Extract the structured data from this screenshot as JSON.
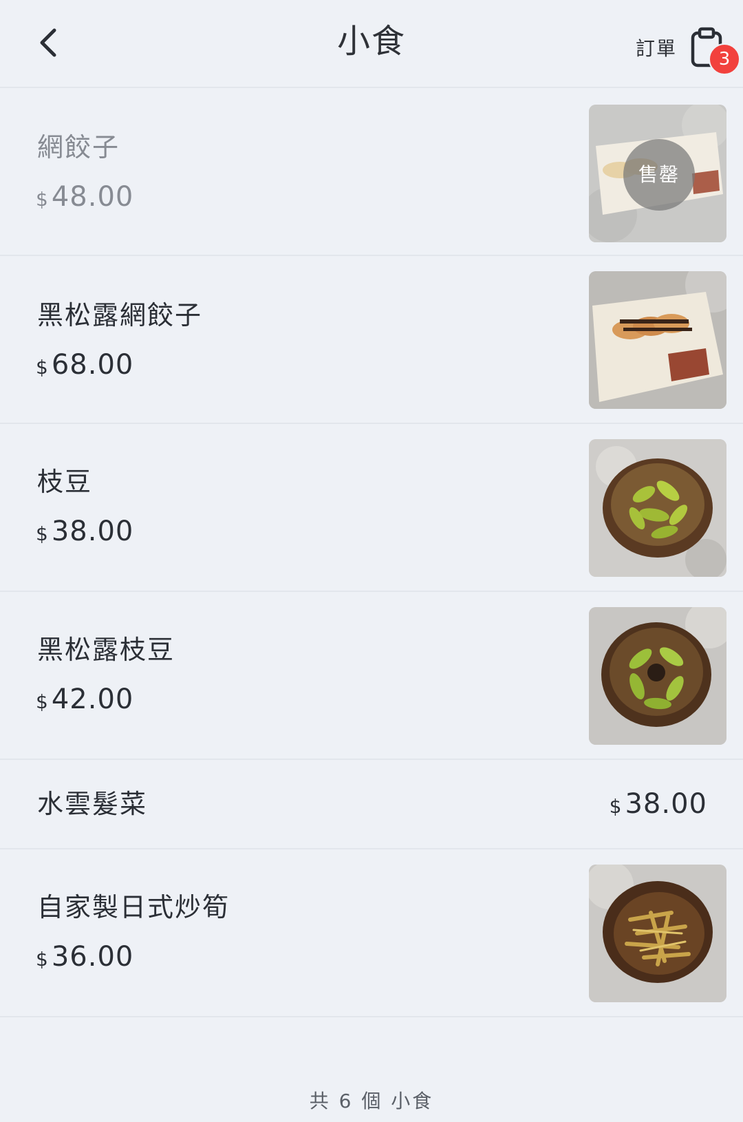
{
  "header": {
    "title": "小食",
    "orders_label": "訂單",
    "order_count": "3"
  },
  "currency_symbol": "$",
  "items": [
    {
      "name": "網餃子",
      "price": "48.00",
      "sold_out": true,
      "sold_out_label": "售罄",
      "thumbnail": "gyoza-plate"
    },
    {
      "name": "黑松露網餃子",
      "price": "68.00",
      "sold_out": false,
      "thumbnail": "gyoza-plate"
    },
    {
      "name": "枝豆",
      "price": "38.00",
      "sold_out": false,
      "thumbnail": "edamame-bowl"
    },
    {
      "name": "黑松露枝豆",
      "price": "42.00",
      "sold_out": false,
      "thumbnail": "truffle-edamame-bowl"
    },
    {
      "name": "水雲髮菜",
      "price": "38.00",
      "sold_out": false
    },
    {
      "name": "自家製日式炒筍",
      "price": "36.00",
      "sold_out": false,
      "thumbnail": "bamboo-shoot-bowl"
    }
  ],
  "footer": {
    "summary": "共 6 個 小食"
  },
  "colors": {
    "background": "#eef1f6",
    "badge": "#f2413d",
    "sold_out_text": "#878b93",
    "divider": "#e2e6ec"
  }
}
